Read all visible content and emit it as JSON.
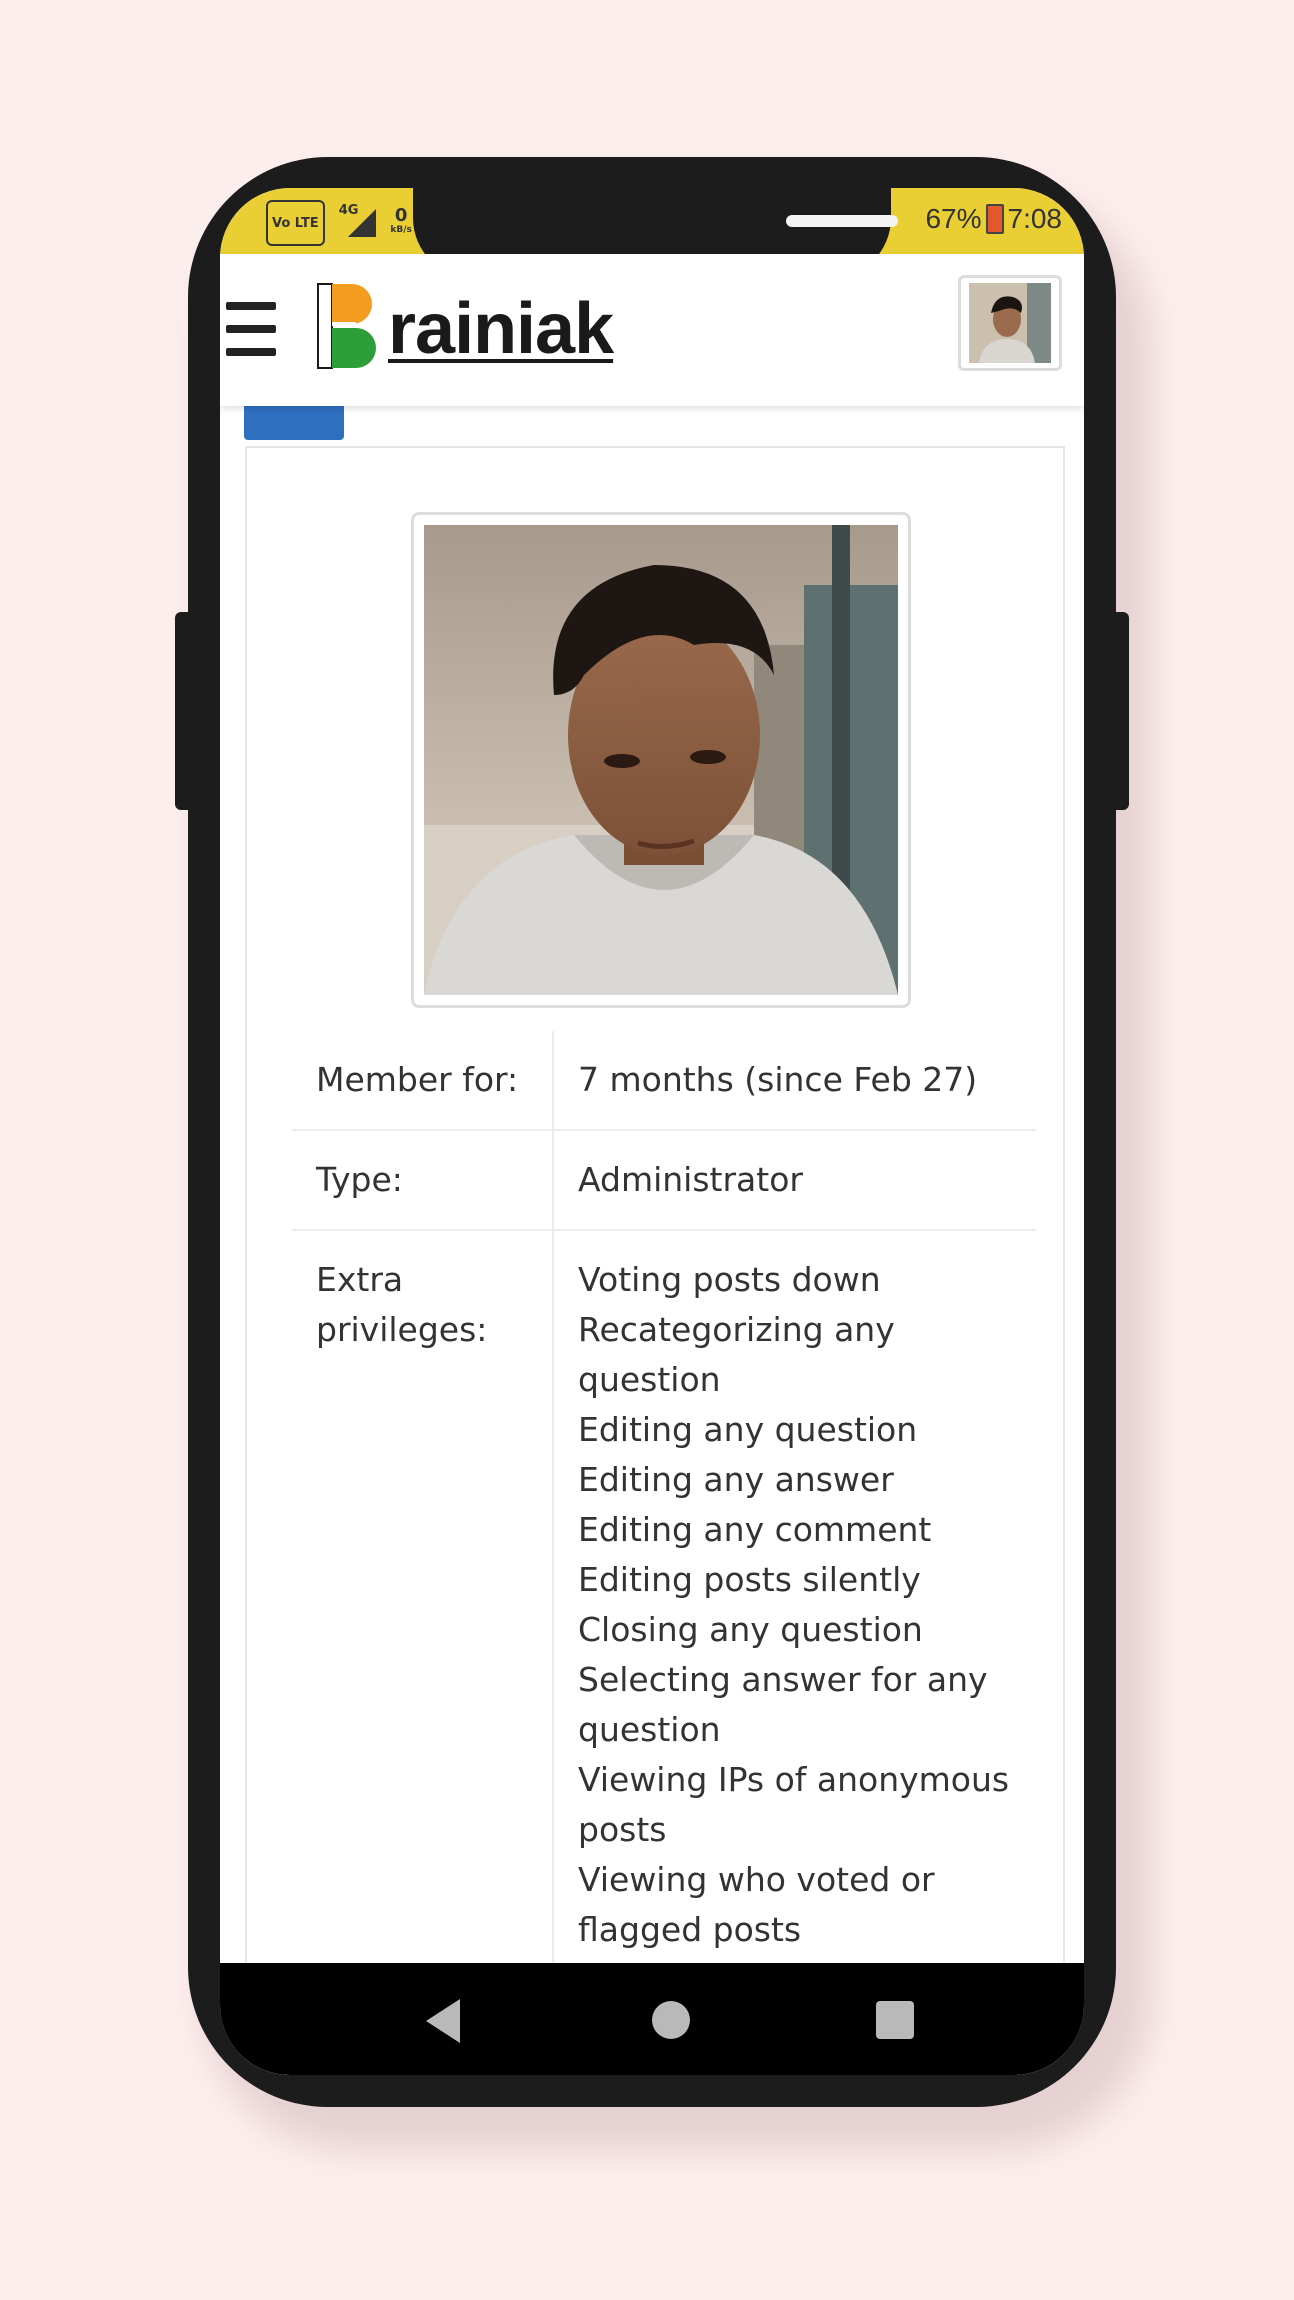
{
  "status_bar": {
    "left_icons": [
      "volte-icon",
      "signal-4g-icon",
      "data-speed-icon"
    ],
    "volte": "Vo LTE",
    "network": "4G",
    "speed": "0",
    "speed_unit": "kB/s",
    "battery_percent": "67%",
    "time": "7:08"
  },
  "app_bar": {
    "logo_text": "rainiak",
    "logo_letter": "B",
    "menu_icon": "hamburger-menu-icon",
    "colors": {
      "saffron": "#f39c1f",
      "green": "#2e9e3a",
      "status_bar": "#e9cf34",
      "accent_blue": "#2f6fc0"
    }
  },
  "profile": {
    "rows": [
      {
        "label": "Member for:",
        "value": "7 months (since Feb 27)"
      },
      {
        "label": "Type:",
        "value": "Administrator"
      }
    ],
    "extra_label": "Extra privileges:",
    "extra_privileges": [
      "Voting posts down",
      "Recategorizing any question",
      "Editing any question",
      "Editing any answer",
      "Editing any comment",
      "Editing posts silently",
      "Closing any question",
      "Selecting answer for any question",
      "Viewing IPs of anonymous posts",
      "Viewing who voted or flagged posts"
    ]
  },
  "nav_bar": {
    "buttons": [
      "back-icon",
      "home-icon",
      "recent-apps-icon"
    ]
  }
}
